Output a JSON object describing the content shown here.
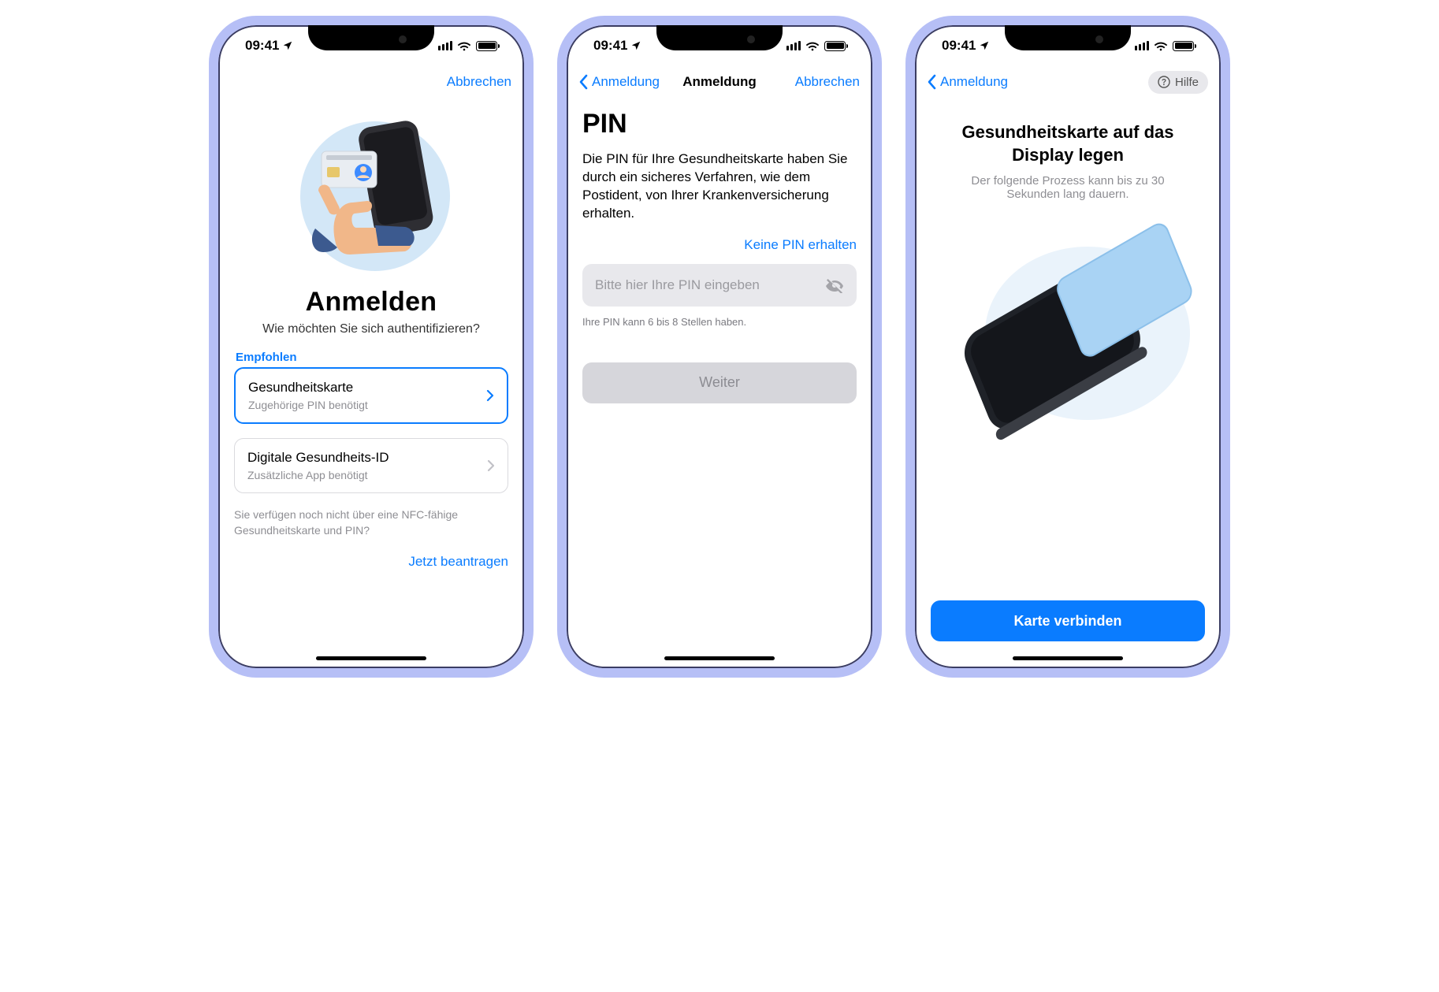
{
  "statusbar": {
    "time": "09:41"
  },
  "screen1": {
    "nav": {
      "cancel": "Abbrechen"
    },
    "title": "Anmelden",
    "subtitle": "Wie möchten Sie sich authentifizieren?",
    "recommended_label": "Empfohlen",
    "option_primary": {
      "title": "Gesundheitskarte",
      "subtitle": "Zugehörige PIN benötigt"
    },
    "option_secondary": {
      "title": "Digitale Gesundheits-ID",
      "subtitle": "Zusätzliche App benötigt"
    },
    "footnote": "Sie verfügen noch nicht über eine NFC-fähige Gesundheitskarte und PIN?",
    "apply_link": "Jetzt beantragen"
  },
  "screen2": {
    "nav": {
      "back": "Anmeldung",
      "title": "Anmeldung",
      "cancel": "Abbrechen"
    },
    "heading": "PIN",
    "body": "Die PIN für Ihre Gesundheitskarte haben Sie durch ein sicheres Verfahren, wie dem Postident, von Ihrer Kranken­versicherung erhalten.",
    "no_pin_link": "Keine PIN erhalten",
    "placeholder": "Bitte hier Ihre PIN eingeben",
    "helper": "Ihre PIN kann 6 bis 8 Stellen haben.",
    "next_button": "Weiter"
  },
  "screen3": {
    "nav": {
      "back": "Anmeldung",
      "help": "Hilfe"
    },
    "heading": "Gesundheitskarte auf das Display legen",
    "subtitle": "Der folgende Prozess kann bis zu 30 Sekunden lang dauern.",
    "connect_button": "Karte verbinden"
  }
}
